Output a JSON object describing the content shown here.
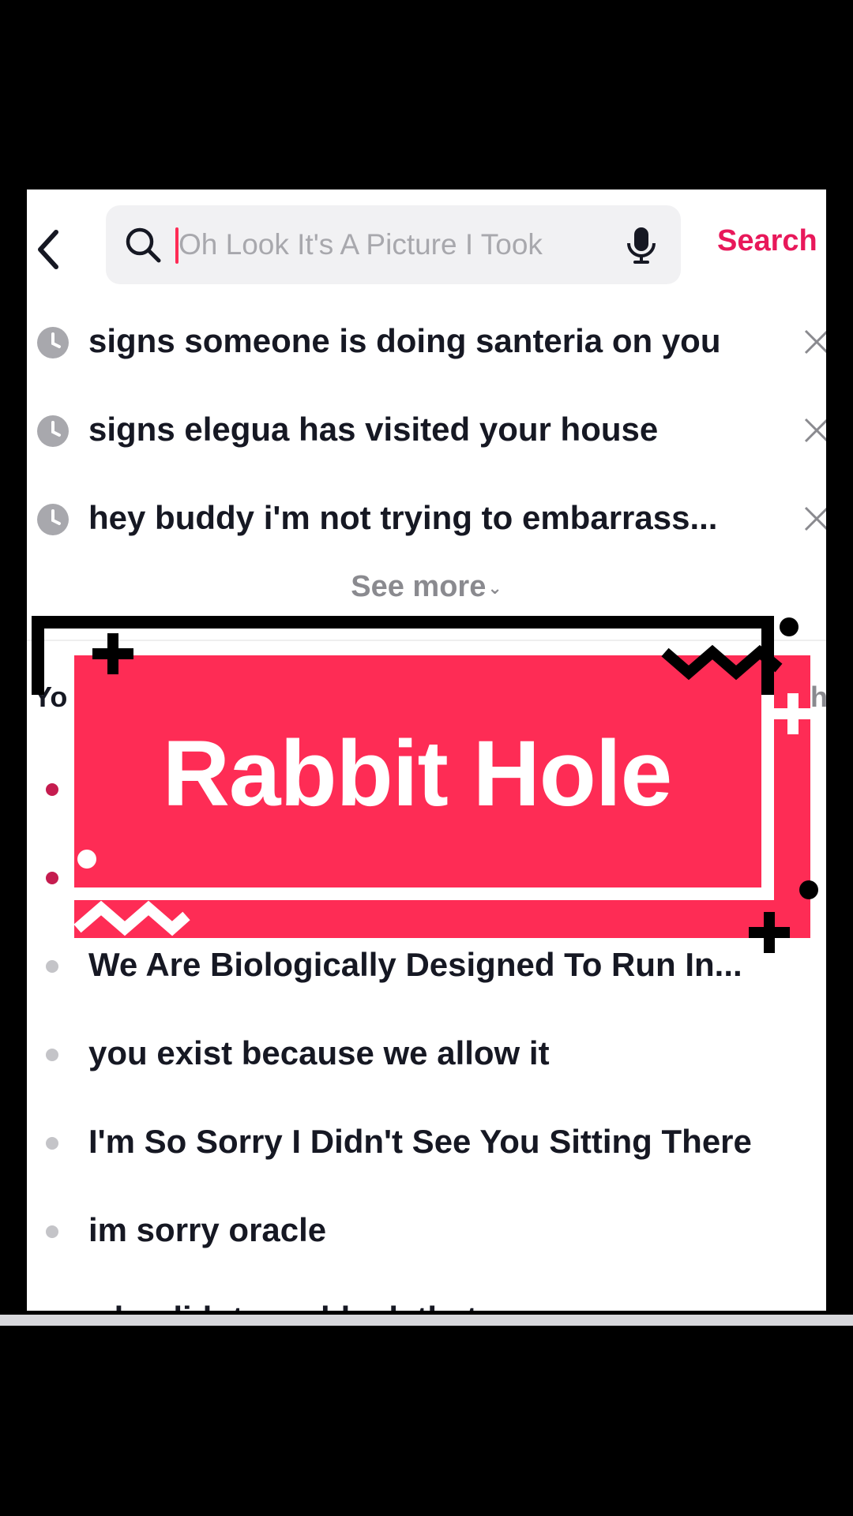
{
  "header": {
    "search_placeholder": "Oh Look It's A Picture I Took",
    "search_button": "Search"
  },
  "history": {
    "items": [
      "signs someone is doing santeria on you",
      "signs elegua has visited your house",
      "hey buddy i'm not trying to embarrass..."
    ],
    "see_more": "See more"
  },
  "suggestions": {
    "title": "Yo",
    "right_fragment": "h",
    "items": [
      "We Are Biologically Designed To Run In...",
      "you exist because we allow it",
      "I'm So Sorry I Didn't See You Sitting There",
      "im sorry oracle",
      "why didnt you block that one"
    ]
  },
  "overlay": {
    "title": "Rabbit Hole",
    "colors": {
      "banner": "#fe2c55",
      "outline": "#000000",
      "accent": "#ffffff"
    }
  },
  "colors": {
    "accent": "#e8185a",
    "text": "#161823",
    "muted": "#8a8a8f"
  },
  "icons": [
    "back-arrow-icon",
    "search-icon",
    "microphone-icon",
    "clock-icon",
    "close-icon",
    "chevron-down-icon"
  ]
}
